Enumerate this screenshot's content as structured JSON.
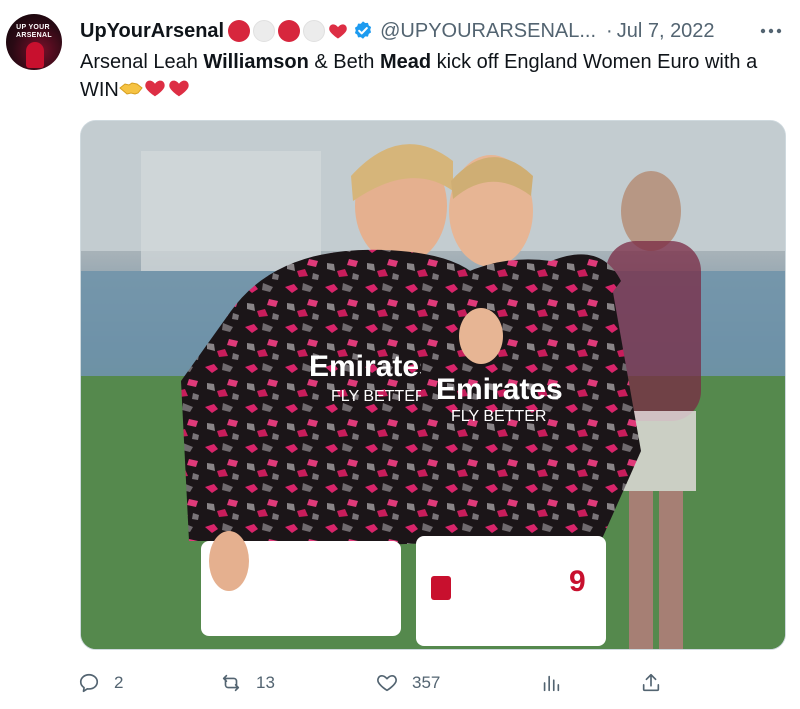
{
  "author": {
    "avatar_text": "UP YOUR ARSENAL",
    "display_name": "UpYourArsenal",
    "handle": "@UPYOURARSENAL...",
    "separator": "·",
    "date": "Jul 7, 2022",
    "flair_emojis": [
      "red-circle",
      "white-circle",
      "red-circle",
      "white-circle",
      "red-heart"
    ],
    "verified": true
  },
  "tweet": {
    "text_part1": "Arsenal Leah ",
    "bold1": "Williamson",
    "text_part2": " & Beth ",
    "bold2": "Mead",
    "text_part3": " kick off England Women Euro with a WIN",
    "trailing_emojis": [
      "handshake",
      "red-heart",
      "red-heart"
    ]
  },
  "media": {
    "shirt_text_left": "Emirates",
    "shirt_sub_left": "FLY BETTER",
    "shirt_text_right": "Emirates",
    "shirt_sub_right": "FLY BETTER"
  },
  "actions": {
    "reply_count": "2",
    "retweet_count": "13",
    "like_count": "357",
    "views_icon": "bar-chart-icon",
    "share_icon": "share-icon"
  },
  "colors": {
    "text_primary": "#0f1419",
    "text_secondary": "#536471",
    "verified_blue": "#1d9bf0",
    "heart_red": "#dd2e44"
  }
}
